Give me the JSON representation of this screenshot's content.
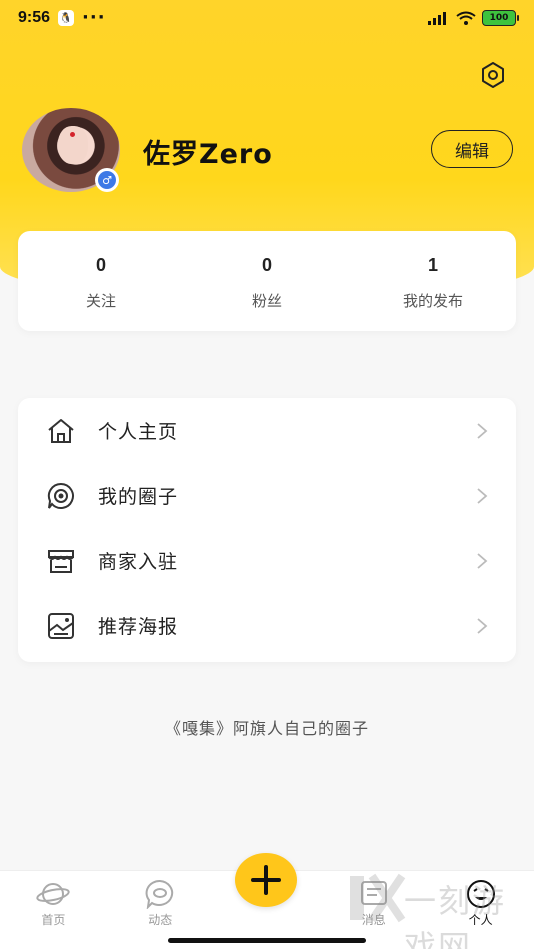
{
  "status_bar": {
    "time": "9:56",
    "battery": "100"
  },
  "profile": {
    "username": "佐罗Zero",
    "gender_symbol": "♂",
    "edit_label": "编辑"
  },
  "stats": [
    {
      "value": "0",
      "label": "关注"
    },
    {
      "value": "0",
      "label": "粉丝"
    },
    {
      "value": "1",
      "label": "我的发布"
    }
  ],
  "menu": [
    {
      "label": "个人主页",
      "icon": "home-icon"
    },
    {
      "label": "我的圈子",
      "icon": "circle-chat-icon"
    },
    {
      "label": "商家入驻",
      "icon": "store-icon"
    },
    {
      "label": "推荐海报",
      "icon": "poster-icon"
    }
  ],
  "footer_text": "《嘎集》阿旗人自己的圈子",
  "tabbar": [
    {
      "label": "首页",
      "icon": "planet-icon"
    },
    {
      "label": "动态",
      "icon": "chat-bubble-icon"
    },
    {
      "label": "消息",
      "icon": "message-icon"
    },
    {
      "label": "个人",
      "icon": "face-icon",
      "active": true
    }
  ],
  "watermark": "一刻游戏网",
  "colors": {
    "accent": "#ffd42a",
    "add_button": "#ffc61a",
    "gender": "#3d79e6"
  }
}
